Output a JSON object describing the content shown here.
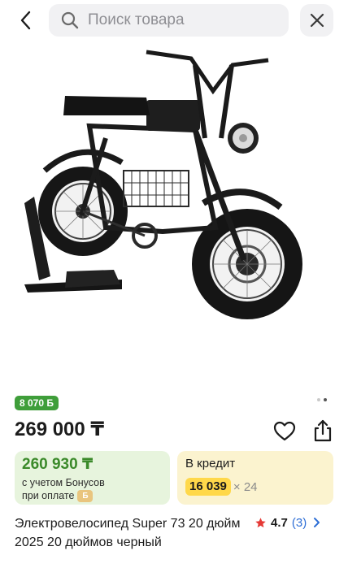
{
  "header": {
    "search_placeholder": "Поиск товара"
  },
  "gallery": {
    "image_alt": "electric-bike-photo",
    "dots_total": 2,
    "dots_active": 1
  },
  "product": {
    "bonus_badge": "8 070 Б",
    "price": "269 000 ₸",
    "bonus_card": {
      "price": "260 930 ₸",
      "note_line1": "с учетом Бонусов",
      "note_line2": "при оплате",
      "coin_symbol": "Б"
    },
    "credit_card": {
      "title": "В кредит",
      "amount": "16 039",
      "multiplier": "× 24"
    },
    "title": "Электровелосипед Super 73 20 дюйм 2025 20 дюймов черный",
    "rating": {
      "value": "4.7",
      "count": "(3)"
    }
  },
  "colors": {
    "accent_green": "#3f9e3a",
    "credit_yellow": "#ffd84a",
    "star_red": "#e53935",
    "link_blue": "#2f6fd6"
  }
}
